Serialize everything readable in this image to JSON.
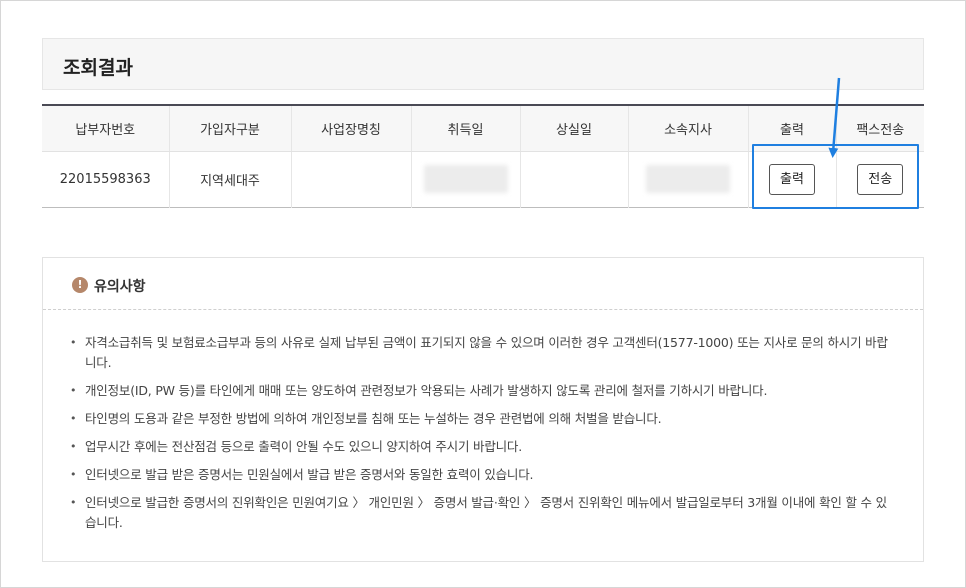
{
  "result": {
    "title": "조회결과",
    "columns": [
      "납부자번호",
      "가입자구분",
      "사업장명칭",
      "취득일",
      "상실일",
      "소속지사",
      "출력",
      "팩스전송"
    ],
    "row": {
      "payer_no": "22015598363",
      "subscriber_type": "지역세대주",
      "workplace_name": "",
      "acquisition_date": "",
      "loss_date": "",
      "branch": "",
      "print_button": "출력",
      "fax_button": "전송"
    }
  },
  "notice": {
    "icon": "!",
    "title": "유의사항",
    "items": [
      "자격소급취득 및 보험료소급부과 등의 사유로 실제 납부된 금액이 표기되지 않을 수 있으며 이러한 경우 고객센터(1577-1000) 또는 지사로 문의 하시기 바랍니다.",
      "개인정보(ID, PW 등)를 타인에게 매매 또는 양도하여 관련정보가 악용되는 사례가 발생하지 않도록 관리에 철저를 기하시기 바랍니다.",
      "타인명의 도용과 같은 부정한 방법에 의하여 개인정보를 침해 또는 누설하는 경우 관련법에 의해 처벌을 받습니다.",
      "업무시간 후에는 전산점검 등으로 출력이 안될 수도 있으니 양지하여 주시기 바랍니다.",
      "인터넷으로 발급 받은 증명서는 민원실에서 발급 받은 증명서와 동일한 효력이 있습니다.",
      "인터넷으로 발급한 증명서의 진위확인은 민원여기요 〉 개인민원 〉 증명서 발급·확인 〉 증명서 진위확인 메뉴에서 발급일로부터 3개월 이내에 확인 할 수 있습니다."
    ]
  },
  "colors": {
    "highlight": "#1f7fe0",
    "notice_icon": "#b5876a"
  }
}
